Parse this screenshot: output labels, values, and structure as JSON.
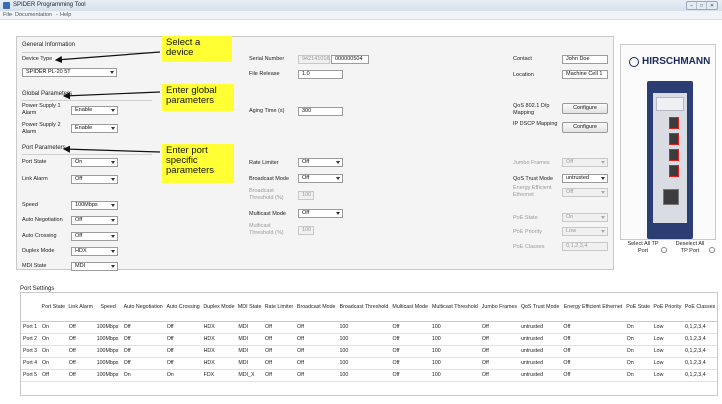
{
  "window": {
    "title": "SPIDER Programming Tool"
  },
  "menu": [
    "File",
    "Documentation",
    "Help"
  ],
  "callouts": {
    "device": "Select a device",
    "global": "Enter global parameters",
    "port": "Enter port specific parameters"
  },
  "general": {
    "section_title": "General Information",
    "device_type_label": "Device Type",
    "device_type_value": "SPIDER PL-20 5T",
    "serial_label": "Serial Number",
    "serial_prefix": "942141016",
    "serial_value": "000000504",
    "file_release_label": "File Release",
    "file_release_value": "1.0",
    "contact_label": "Contact",
    "contact_value": "John Doe",
    "location_label": "Location",
    "location_value": "Machine Cell 1"
  },
  "global": {
    "section_title": "Global Parameters",
    "ps1_label": "Power Supply 1 Alarm",
    "ps1_value": "Enable",
    "ps2_label": "Power Supply 2 Alarm",
    "ps2_value": "Enable",
    "aging_label": "Aging Time (s)",
    "aging_value": "300",
    "qos_label": "QoS 802.1 D/p Mapping",
    "dscp_label": "IP DSCP Mapping",
    "configure_label": "Configure"
  },
  "port": {
    "section_title": "Port Parameters",
    "port_state_label": "Port State",
    "port_state_value": "On",
    "link_alarm_label": "Link Alarm",
    "link_alarm_value": "Off",
    "speed_label": "Speed",
    "speed_value": "100Mbps",
    "autoneg_label": "Auto Negotiation",
    "autoneg_value": "Off",
    "autocross_label": "Auto Crossing",
    "autocross_value": "Off",
    "duplex_label": "Duplex Mode",
    "duplex_value": "HDX",
    "mdi_label": "MDI State",
    "mdi_value": "MDI",
    "rate_limiter_label": "Rate Limiter",
    "rate_limiter_value": "Off",
    "bcast_mode_label": "Broadcast Mode",
    "bcast_mode_value": "Off",
    "bcast_thr_label": "Broadcast Threshold (%)",
    "bcast_thr_value": "100",
    "mcast_mode_label": "Multicast Mode",
    "mcast_mode_value": "Off",
    "mcast_thr_label": "Multicast Threshold (%)",
    "mcast_thr_value": "100",
    "jumbo_label": "Jumbo Frames",
    "jumbo_value": "Off",
    "qos_trust_label": "QoS Trust Mode",
    "qos_trust_value": "untrusted",
    "eee_label": "Energy Efficient Ethernet",
    "eee_value": "Off",
    "poe_state_label": "PoE State",
    "poe_state_value": "On",
    "poe_priority_label": "PoE Priority",
    "poe_priority_value": "Low",
    "poe_classes_label": "PoE Classes",
    "poe_classes_value": "0,1,2,3,4"
  },
  "device": {
    "logo_text": "HIRSCHMANN",
    "select_all": "Select All TP Port",
    "deselect_all": "Deselect All TP Port"
  },
  "port_settings": {
    "section_title": "Port Settings",
    "columns": [
      "",
      "Port State",
      "Link Alarm",
      "Speed",
      "Auto Negotiation",
      "Auto Crossing",
      "Duplex Mode",
      "MDI State",
      "Rate Limiter",
      "Broadcast Mode",
      "Broadcast Threshold",
      "Multicast Mode",
      "Multicast Threshold",
      "Jumbo Frames",
      "QoS Trust Mode",
      "Energy Efficient Ethernet",
      "PoE State",
      "PoE Priority",
      "PoE Classes"
    ],
    "rows": [
      [
        "Port 1",
        "On",
        "Off",
        "100Mbps",
        "Off",
        "Off",
        "HDX",
        "MDI",
        "Off",
        "Off",
        "100",
        "Off",
        "100",
        "Off",
        "untrusted",
        "Off",
        "On",
        "Low",
        "0,1,2,3,4"
      ],
      [
        "Port 2",
        "On",
        "Off",
        "100Mbps",
        "Off",
        "Off",
        "HDX",
        "MDI",
        "Off",
        "Off",
        "100",
        "Off",
        "100",
        "Off",
        "untrusted",
        "Off",
        "On",
        "Low",
        "0,1,2,3,4"
      ],
      [
        "Port 3",
        "On",
        "Off",
        "100Mbps",
        "Off",
        "Off",
        "HDX",
        "MDI",
        "Off",
        "Off",
        "100",
        "Off",
        "100",
        "Off",
        "untrusted",
        "Off",
        "On",
        "Low",
        "0,1,2,3,4"
      ],
      [
        "Port 4",
        "On",
        "Off",
        "100Mbps",
        "Off",
        "Off",
        "HDX",
        "MDI",
        "Off",
        "Off",
        "100",
        "Off",
        "100",
        "Off",
        "untrusted",
        "Off",
        "On",
        "Low",
        "0,1,2,3,4"
      ],
      [
        "Port 5",
        "Off",
        "Off",
        "100Mbps",
        "On",
        "On",
        "FDX",
        "MDI_X",
        "Off",
        "Off",
        "100",
        "Off",
        "100",
        "Off",
        "untrusted",
        "Off",
        "On",
        "Low",
        "0,1,2,3,4"
      ]
    ]
  }
}
